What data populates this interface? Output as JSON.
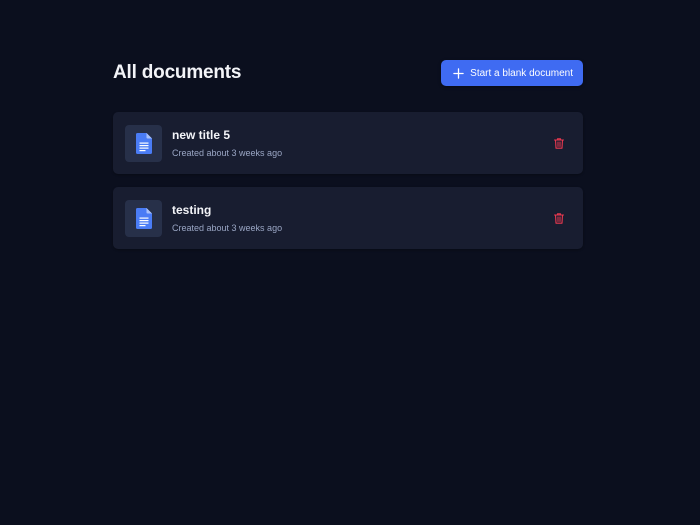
{
  "header": {
    "title": "All documents",
    "new_button_label": "Start a blank document"
  },
  "documents": [
    {
      "title": "new title 5",
      "meta": "Created about 3 weeks ago"
    },
    {
      "title": "testing",
      "meta": "Created about 3 weeks ago"
    }
  ],
  "colors": {
    "background": "#0b0f1e",
    "card": "#181d30",
    "accent": "#3f6bf2",
    "doc_icon": "#4a7cf5",
    "delete": "#e8384f"
  },
  "icons": {
    "new_button": "plus-icon",
    "document": "document-icon",
    "delete": "trash-icon"
  }
}
